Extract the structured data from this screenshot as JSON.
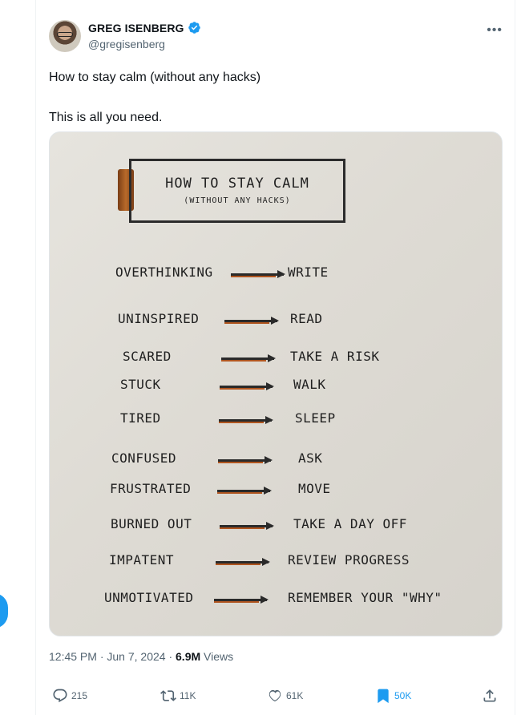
{
  "author": {
    "name": "GREG ISENBERG",
    "handle": "@gregisenberg",
    "verified_color": "#1d9bf0"
  },
  "more_glyph": "•••",
  "tweet": {
    "line1": "How to stay calm (without any hacks)",
    "line2": "This is all you need."
  },
  "image": {
    "title": "HOW TO STAY CALM",
    "subtitle": "(WITHOUT ANY HACKS)",
    "rows": [
      {
        "feeling": "OVERTHINKING",
        "action": "WRITE"
      },
      {
        "feeling": "UNINSPIRED",
        "action": "READ"
      },
      {
        "feeling": "SCARED",
        "action": "TAKE A RISK"
      },
      {
        "feeling": "STUCK",
        "action": "WALK"
      },
      {
        "feeling": "TIRED",
        "action": "SLEEP"
      },
      {
        "feeling": "CONFUSED",
        "action": "ASK"
      },
      {
        "feeling": "FRUSTRATED",
        "action": "MOVE"
      },
      {
        "feeling": "BURNED OUT",
        "action": "TAKE A DAY OFF"
      },
      {
        "feeling": "IMPATENT",
        "action": "REVIEW PROGRESS"
      },
      {
        "feeling": "UNMOTIVATED",
        "action": "REMEMBER YOUR \"WHY\""
      }
    ]
  },
  "meta": {
    "time": "12:45 PM",
    "date": "Jun 7, 2024",
    "views_count": "6.9M",
    "views_label": "Views",
    "separator": "·"
  },
  "actions": {
    "replies": "215",
    "reposts": "11K",
    "likes": "61K",
    "bookmarks": "50K"
  },
  "colors": {
    "accent": "#1d9bf0",
    "muted": "#536471",
    "text": "#0f1419"
  }
}
